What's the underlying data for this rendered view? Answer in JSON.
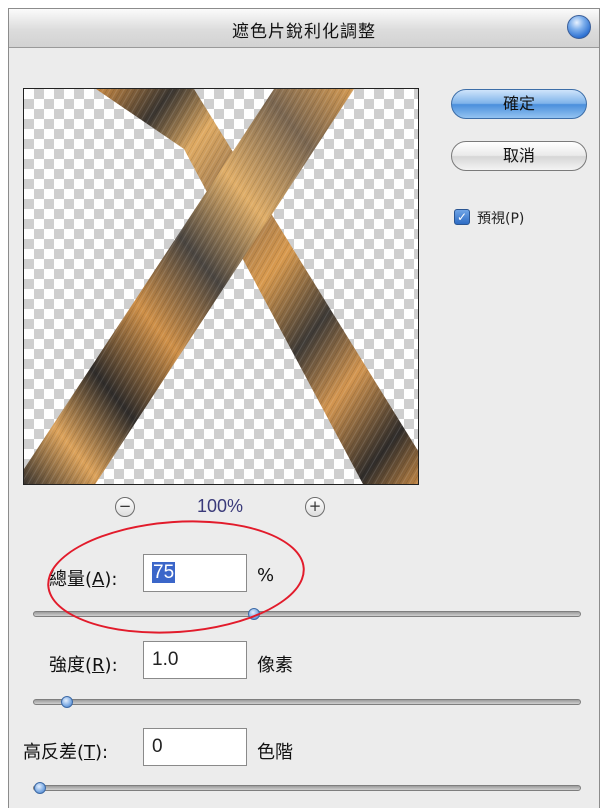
{
  "dialog": {
    "title": "遮色片銳利化調整",
    "ok_label": "確定",
    "cancel_label": "取消",
    "preview_checkbox": {
      "label": "預視(P)",
      "checked": true
    }
  },
  "preview": {
    "zoom_out_symbol": "−",
    "zoom_level": "100%",
    "zoom_in_symbol": "+"
  },
  "fields": {
    "amount": {
      "label_prefix": "總量(",
      "label_key": "A",
      "label_suffix": "):",
      "value": "75",
      "unit": "%",
      "slider_fraction": 0.4
    },
    "radius": {
      "label_prefix": "強度(",
      "label_key": "R",
      "label_suffix": "):",
      "value": "1.0",
      "unit": "像素",
      "slider_fraction": 0.05
    },
    "threshold": {
      "label_prefix": "高反差(",
      "label_key": "T",
      "label_suffix": "):",
      "value": "0",
      "unit": "色階",
      "slider_fraction": 0.0
    }
  },
  "colors": {
    "accent_blue": "#4a8fdc",
    "annotation_red": "#e21b2b",
    "fur_light": "#d9a45c",
    "fur_dark": "#3a3530"
  },
  "icons": {
    "title_orb": "aqua-orb-icon",
    "zoom_out": "zoom-out-icon",
    "zoom_in": "zoom-in-icon",
    "checkbox": "checkmark-icon"
  }
}
